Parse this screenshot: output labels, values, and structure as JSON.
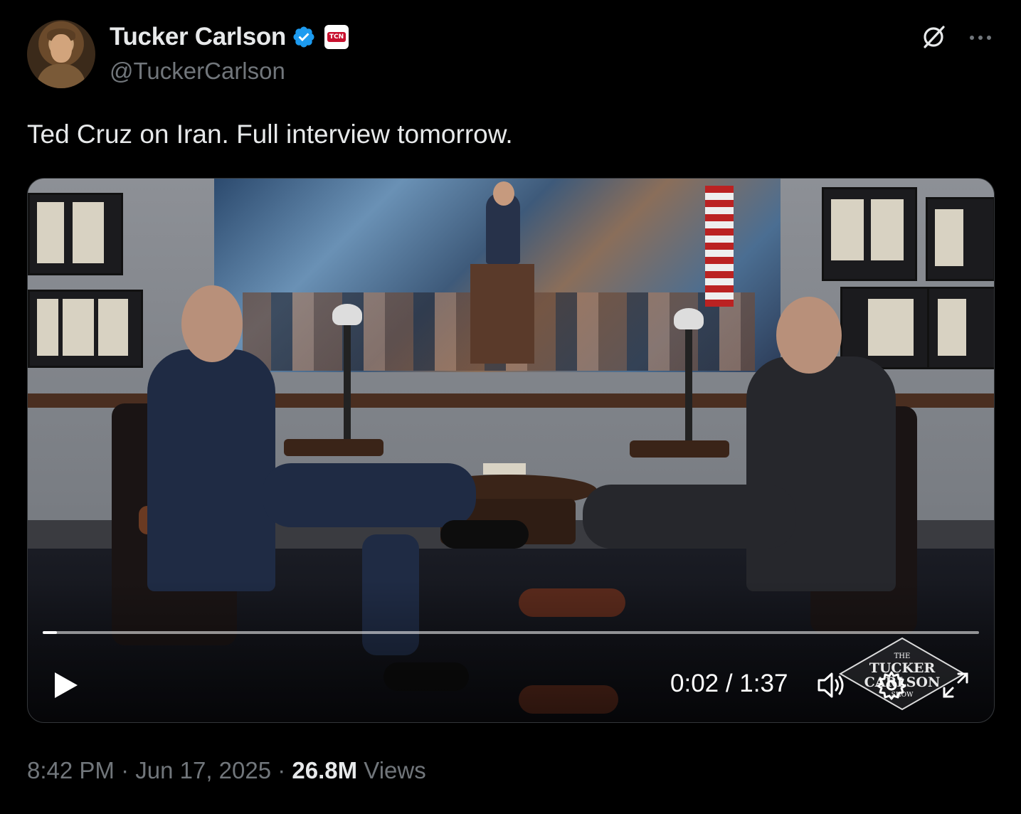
{
  "author": {
    "display_name": "Tucker Carlson",
    "handle": "@TuckerCarlson",
    "affiliate_badge": "TCN",
    "verified": true,
    "verified_color": "#1d9bf0"
  },
  "tweet": {
    "text": "Ted Cruz on Iran. Full interview tomorrow."
  },
  "video": {
    "time_display": "0:02 / 1:37",
    "progress": 0.015,
    "watermark_text": "THE TUCKER CARLSON SHOW",
    "controls": [
      "play-icon",
      "volume-icon",
      "settings-icon",
      "fullscreen-icon"
    ]
  },
  "meta": {
    "time": "8:42 PM",
    "separator": " · ",
    "date": "Jun 17, 2025",
    "views_count": "26.8M",
    "views_label": "Views"
  },
  "colors": {
    "background": "#000000",
    "text_primary": "#e7e9ea",
    "text_secondary": "#71767b",
    "border": "#333639"
  }
}
